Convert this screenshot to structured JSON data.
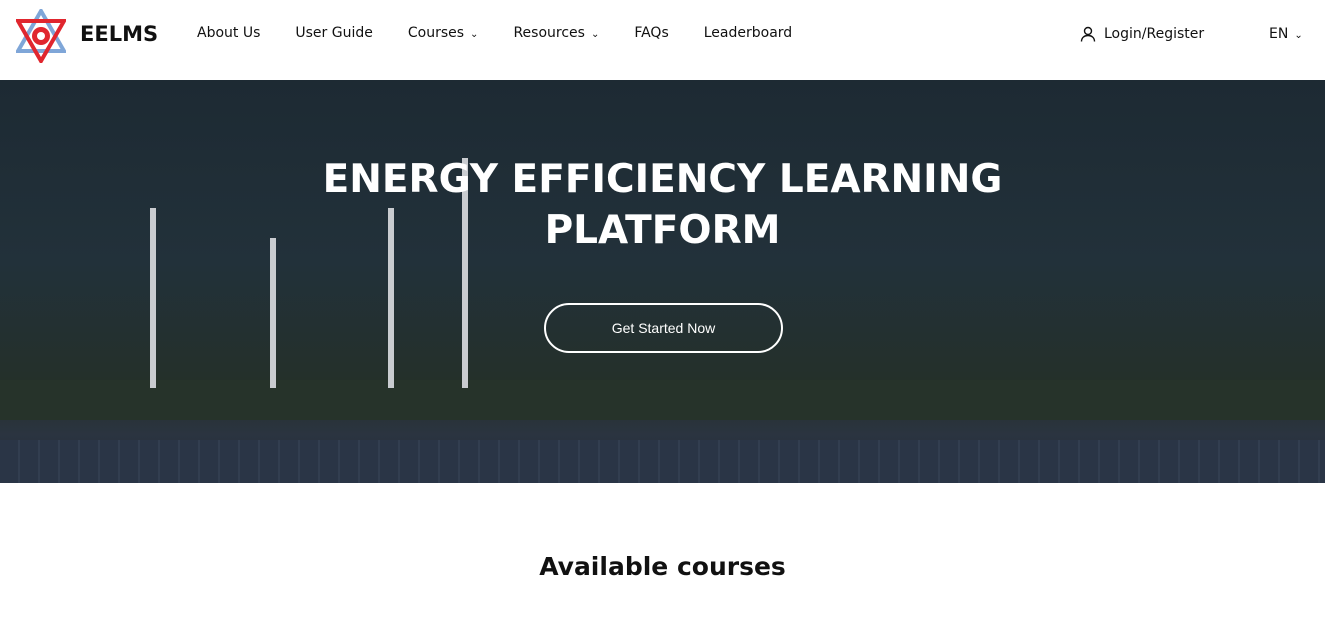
{
  "brand": {
    "name": "EELMS"
  },
  "nav": {
    "items": [
      {
        "label": "About Us"
      },
      {
        "label": "User Guide"
      },
      {
        "label": "Courses",
        "dropdown": true
      },
      {
        "label": "Resources",
        "dropdown": true
      },
      {
        "label": "FAQs"
      },
      {
        "label": "Leaderboard"
      }
    ],
    "login": "Login/Register",
    "language": "EN"
  },
  "hero": {
    "title_line1": "ENERGY EFFICIENCY LEARNING",
    "title_line2": "PLATFORM",
    "cta": "Get Started Now"
  },
  "courses": {
    "heading": "Available courses"
  }
}
